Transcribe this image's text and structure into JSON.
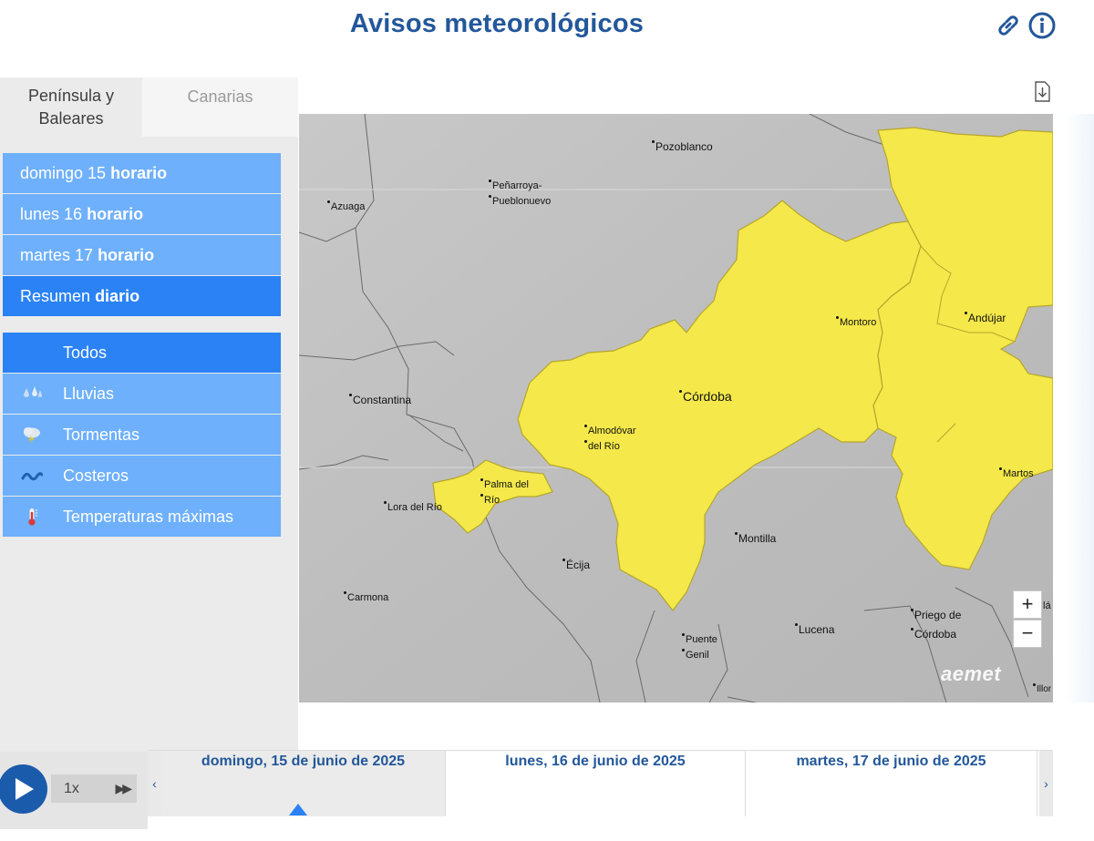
{
  "header": {
    "title": "Avisos meteorológicos",
    "link_icon": "link-icon",
    "info_icon": "info-icon"
  },
  "tabs": [
    {
      "label_line1": "Península y",
      "label_line2": "Baleares",
      "active": true
    },
    {
      "label": "Canarias",
      "active": false
    }
  ],
  "days": [
    {
      "day": "domingo 15",
      "mode": "horario"
    },
    {
      "day": "lunes 16",
      "mode": "horario"
    },
    {
      "day": "martes 17",
      "mode": "horario"
    },
    {
      "day": "Resumen",
      "mode": "diario",
      "active": true
    }
  ],
  "types": [
    {
      "label": "Todos",
      "icon": "none",
      "active": true
    },
    {
      "label": "Lluvias",
      "icon": "rain-icon"
    },
    {
      "label": "Tormentas",
      "icon": "storm-icon"
    },
    {
      "label": "Costeros",
      "icon": "wave-icon"
    },
    {
      "label": "Temperaturas máximas",
      "icon": "thermometer-icon"
    }
  ],
  "download_icon": "download-icon",
  "map": {
    "warning_color": "#f4e84a",
    "cities": {
      "pozoblanco": "Pozoblanco",
      "penarroya_1": "Peñarroya-",
      "penarroya_2": "Pueblonuevo",
      "azuaga": "Azuaga",
      "montoro": "Montoro",
      "andujar": "Andújar",
      "constantina": "Constantina",
      "cordoba": "Córdoba",
      "almodovar_1": "Almodóvar",
      "almodovar_2": "del Río",
      "palma_1": "Palma del",
      "palma_2": "Río",
      "lora": "Lora del Río",
      "martos": "Martos",
      "montilla": "Montilla",
      "ecija": "Écija",
      "carmona": "Carmona",
      "priego_1": "Priego de",
      "priego_2": "Córdoba",
      "lucena": "Lucena",
      "puente_1": "Puente",
      "puente_2": "Genil",
      "edge_la": "lá",
      "edge_illo": "Illor"
    },
    "zoom_in": "+",
    "zoom_out": "−",
    "logo": "aemet"
  },
  "player": {
    "speed": "1x",
    "fast_forward": "▶▶"
  },
  "timeline": {
    "prev": "‹",
    "next": "›",
    "days": [
      "domingo, 15 de junio de 2025",
      "lunes, 16 de junio de 2025",
      "martes, 17 de junio de 2025"
    ]
  }
}
